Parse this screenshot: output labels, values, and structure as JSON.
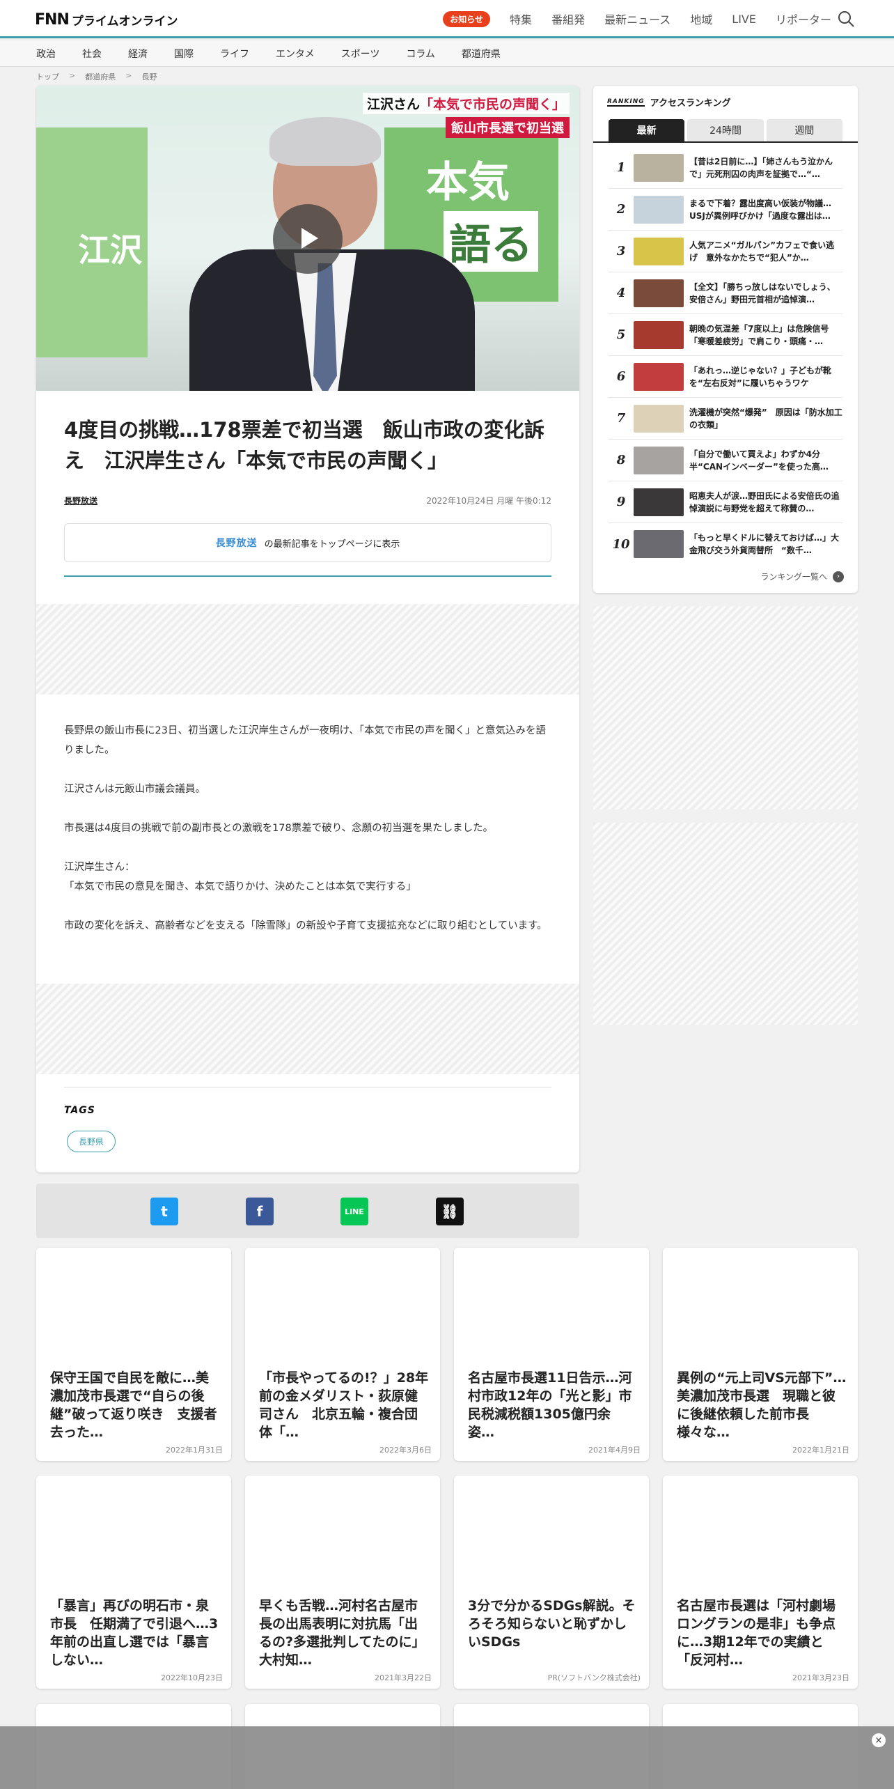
{
  "header": {
    "logo_fnn": "FNN",
    "logo_sub": "プライムオンライン",
    "news_badge": "お知らせ",
    "nav": [
      "特集",
      "番組発",
      "最新ニュース",
      "地域",
      "LIVE",
      "リポーター"
    ]
  },
  "categories": [
    "政治",
    "社会",
    "経済",
    "国際",
    "ライフ",
    "エンタメ",
    "スポーツ",
    "コラム",
    "都道府県"
  ],
  "breadcrumb": [
    "トップ",
    "都道府県",
    "長野"
  ],
  "video": {
    "caption_line1_prefix": "江沢さん",
    "caption_line1_highlight": "「本気で市民の声聞く」",
    "caption_line2": "飯山市長選で初当選",
    "board_text_1": "本気",
    "board_text_2": "語る",
    "board_left_text": "江沢"
  },
  "article": {
    "headline": "4度目の挑戦…178票差で初当選　飯山市政の変化訴え　江沢岸生さん「本気で市民の声聞く」",
    "source": "長野放送",
    "date": "2022年10月24日 月曜 午後0:12",
    "topbtn_brand": "長野放送",
    "topbtn_text": "の最新記事をトップページに表示",
    "paragraphs": [
      "長野県の飯山市長に23日、初当選した江沢岸生さんが一夜明け、「本気で市民の声を聞く」と意気込みを語りました。",
      "江沢さんは元飯山市議会議員。",
      "市長選は4度目の挑戦で前の副市長との激戦を178票差で破り、念願の初当選を果たしました。",
      "江沢岸生さん：",
      "「本気で市民の意見を聞き、本気で語りかけ、決めたことは本気で実行する」",
      "市政の変化を訴え、高齢者などを支える「除雪隊」の新設や子育て支援拡充などに取り組むとしています。"
    ],
    "tags_title": "TAGS",
    "tags": [
      "長野県"
    ]
  },
  "share": {
    "twitter": "t",
    "facebook": "f",
    "line": "LINE",
    "link": "⛓"
  },
  "ranking": {
    "label_en": "RANKING",
    "label_ja": "アクセスランキング",
    "tabs": [
      "最新",
      "24時間",
      "週間"
    ],
    "active_tab": "最新",
    "items": [
      {
        "rank": "1",
        "title": "【昔は2日前に…】「姉さんもう泣かんで」元死刑囚の肉声を証拠で…“…"
      },
      {
        "rank": "2",
        "title": "まるで下着？露出度高い仮装が物議…USJが異例呼びかけ「過度な露出は…"
      },
      {
        "rank": "3",
        "title": "人気アニメ“ガルパン”カフェで食い逃げ　意外なかたちで“犯人”か…"
      },
      {
        "rank": "4",
        "title": "【全文】「勝ちっ放しはないでしょう、安倍さん」野田元首相が追悼演…"
      },
      {
        "rank": "5",
        "title": "朝晩の気温差「7度以上」は危険信号「寒暖差疲労」で肩こり・頭痛・…"
      },
      {
        "rank": "6",
        "title": "「あれっ…逆じゃない？」子どもが靴を“左右反対”に履いちゃうワケ"
      },
      {
        "rank": "7",
        "title": "洗濯機が突然“爆発”　原因は「防水加工の衣類」"
      },
      {
        "rank": "8",
        "title": "「自分で働いて買えよ」わずか4分半“CANインベーダー”を使った高…"
      },
      {
        "rank": "9",
        "title": "昭恵夫人が涙…野田氏による安倍氏の追悼演説に与野党を超えて称賛の…"
      },
      {
        "rank": "10",
        "title": "「もっと早くドルに替えておけば…」大金飛び交う外貨両替所　“数千…"
      }
    ],
    "more": "ランキング一覧へ",
    "thumb_colors": [
      "#b9b29f",
      "#c6d2dc",
      "#d9c44a",
      "#7a4a3a",
      "#a63a2f",
      "#c23d3d",
      "#ddd2b8",
      "#a6a3a0",
      "#3a3838",
      "#6a6a70"
    ]
  },
  "related": [
    {
      "title": "保守王国で自民を敵に…美濃加茂市長選で“自らの後継”破って返り咲き　支援者去った…",
      "date": "2022年1月31日"
    },
    {
      "title": "「市長やってるの!？」28年前の金メダリスト・荻原健司さん　北京五輪・複合団体「…",
      "date": "2022年3月6日"
    },
    {
      "title": "名古屋市長選11日告示…河村市政12年の「光と影」市民税減税額1305億円余 姿…",
      "date": "2021年4月9日"
    },
    {
      "title": "異例の“元上司VS元部下”…美濃加茂市長選　現職と彼に後継依頼した前市長　様々な…",
      "date": "2022年1月21日"
    },
    {
      "title": "「暴言」再びの明石市・泉市長　任期満了で引退へ…3年前の出直し選では「暴言しない…",
      "date": "2022年10月23日"
    },
    {
      "title": "早くも舌戦…河村名古屋市長の出馬表明に対抗馬「出るの?多選批判してたのに」大村知…",
      "date": "2021年3月22日"
    },
    {
      "title": "3分で分かるSDGs解説。そろそろ知らないと恥ずかしいSDGs",
      "date": "PR(ソフトバンク株式会社)"
    },
    {
      "title": "名古屋市長選は「河村劇場ロングランの是非」も争点に…3期12年での実績と「反河村…",
      "date": "2021年3月23日"
    }
  ],
  "bottom_bar": {
    "close": "×"
  }
}
